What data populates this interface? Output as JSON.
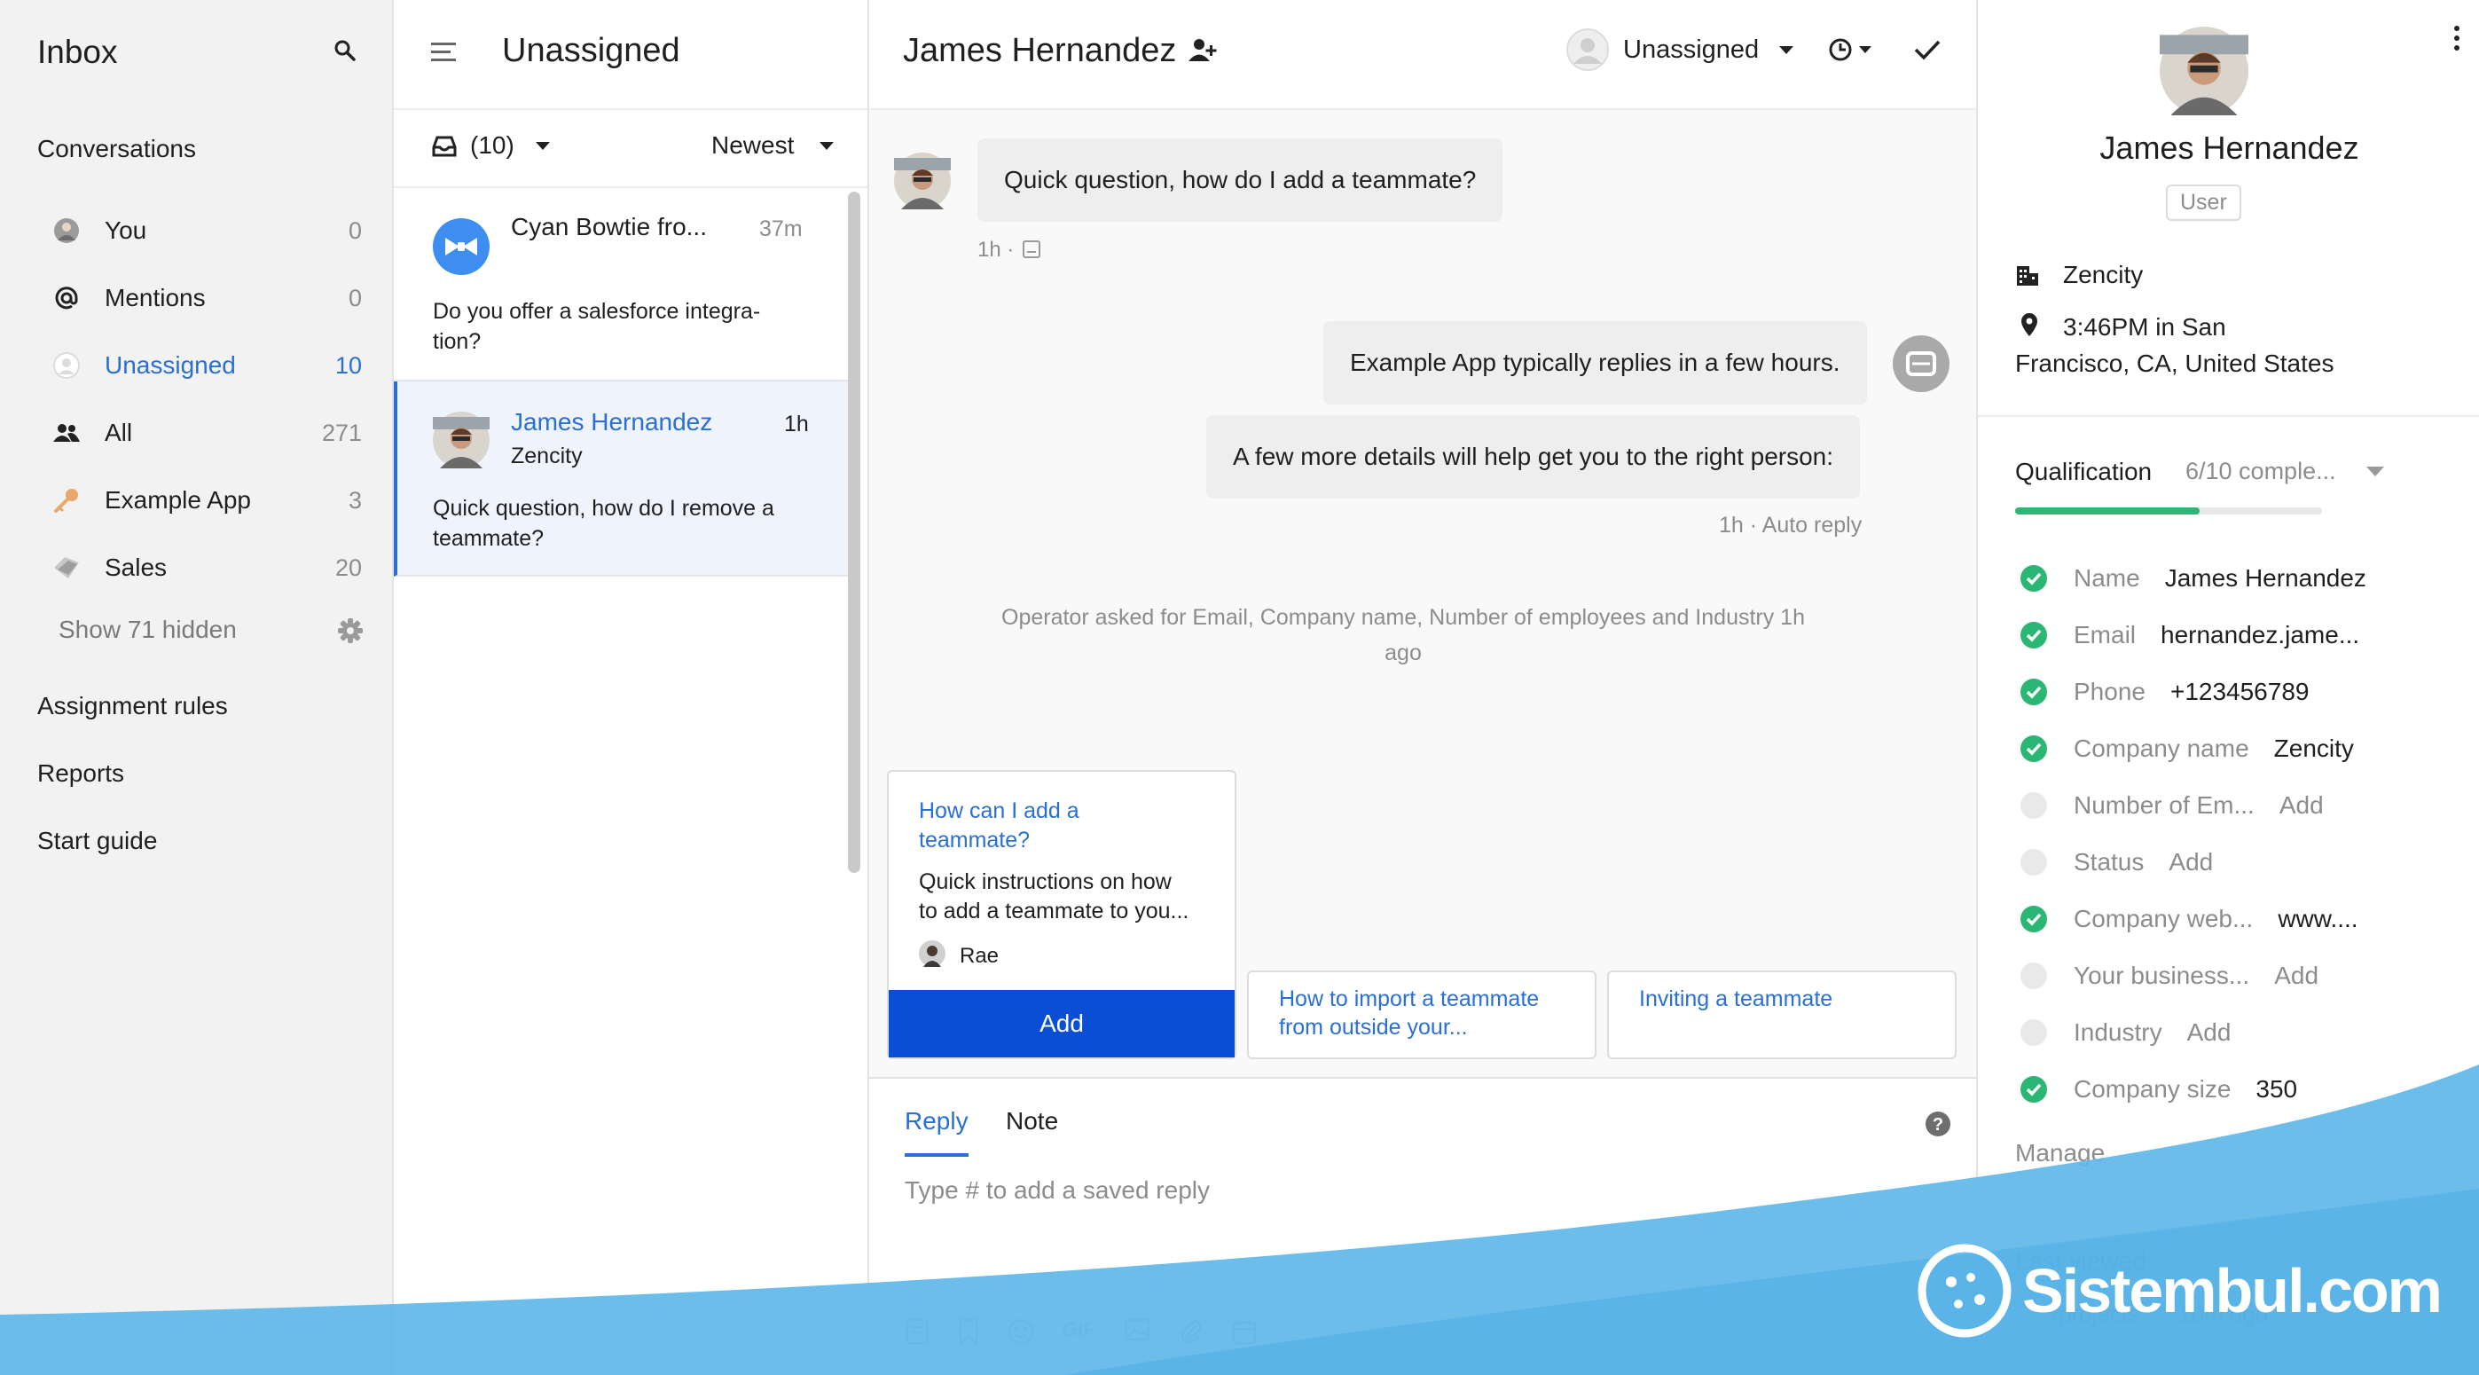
{
  "sidebar": {
    "title": "Inbox",
    "section": "Conversations",
    "items": [
      {
        "label": "You",
        "count": "0",
        "icon": "avatar-icon"
      },
      {
        "label": "Mentions",
        "count": "0",
        "icon": "at-icon"
      },
      {
        "label": "Unassigned",
        "count": "10",
        "icon": "person-outline-icon"
      },
      {
        "label": "All",
        "count": "271",
        "icon": "people-icon"
      },
      {
        "label": "Example App",
        "count": "3",
        "icon": "key-icon"
      },
      {
        "label": "Sales",
        "count": "20",
        "icon": "tag-icon"
      }
    ],
    "show_hidden": "Show 71 hidden",
    "links": [
      "Assignment rules",
      "Reports",
      "Start guide"
    ]
  },
  "list": {
    "title": "Unassigned",
    "count_label": "(10)",
    "sort": "Newest",
    "conversations": [
      {
        "name": "Cyan Bowtie fro...",
        "time": "37m",
        "company": "",
        "preview": "Do you offer a salesforce integra-\ntion?"
      },
      {
        "name": "James Hernandez",
        "time": "1h",
        "company": "Zencity",
        "preview": "Quick question, how do I remove a\nteammate?"
      }
    ]
  },
  "main": {
    "title": "James Hernandez",
    "assignee": "Unassigned",
    "messages": {
      "user_msg": "Quick question, how do I add a teammate?",
      "user_meta": "1h ·",
      "bot_msg1": "Example App typically replies in a few hours.",
      "bot_msg2": "A few more details will help get you to the right person:",
      "bot_meta": "1h · Auto reply",
      "operator_note": "Operator asked for Email, Company name, Number of employees and Industry 1h\nago"
    },
    "article": {
      "title": "How can I add a\nteammate?",
      "desc": "Quick instructions on how\nto add a teammate to you...",
      "author": "Rae",
      "add_label": "Add"
    },
    "suggestions": [
      "How to import a teammate\nfrom outside your...",
      "Inviting a teammate"
    ],
    "composer": {
      "tab_reply": "Reply",
      "tab_note": "Note",
      "placeholder": "Type # to add a saved reply",
      "gif": "GIF"
    }
  },
  "right": {
    "name": "James Hernandez",
    "role": "User",
    "company": "Zencity",
    "location": "3:46PM in San\nFrancisco, CA, United States",
    "qualification_label": "Qualification",
    "qualification_status": "6/10 comple...",
    "qualification_progress": 0.6,
    "fields": [
      {
        "k": "Name",
        "v": "James Hernandez",
        "done": true
      },
      {
        "k": "Email",
        "v": "hernandez.jame...",
        "done": true
      },
      {
        "k": "Phone",
        "v": "+123456789",
        "done": true
      },
      {
        "k": "Company name",
        "v": "Zencity",
        "done": true
      },
      {
        "k": "Number of Em...",
        "v": "Add",
        "done": false
      },
      {
        "k": "Status",
        "v": "Add",
        "done": false
      },
      {
        "k": "Company web...",
        "v": "www....",
        "done": true
      },
      {
        "k": "Your business...",
        "v": "Add",
        "done": false
      },
      {
        "k": "Industry",
        "v": "Add",
        "done": false
      },
      {
        "k": "Company size",
        "v": "350",
        "done": true
      }
    ],
    "manage": "Manage",
    "last_viewed_label": "Last viewed",
    "last_viewed_path": "/projects",
    "last_viewed_time": "10m ago"
  },
  "watermark": {
    "text": "Sistembul.com"
  },
  "colors": {
    "accent": "#2a6fd4",
    "primary_button": "#0a4ed6",
    "success": "#2bb673",
    "wave": "#5fb7e8"
  }
}
